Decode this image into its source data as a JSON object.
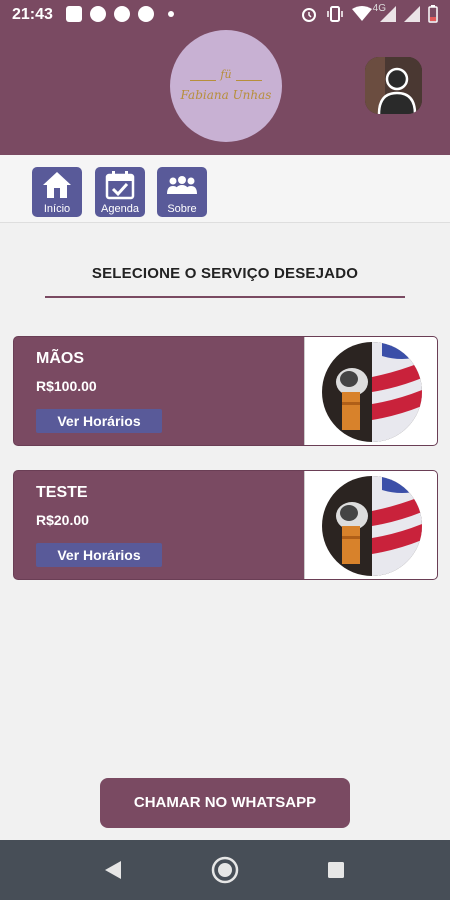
{
  "status_bar": {
    "time": "21:43",
    "network": "4G",
    "icons": [
      "message-icon",
      "facebook-icon",
      "pinterest-icon",
      "pinterest-icon",
      "dot-icon",
      "alarm-icon",
      "vibrate-icon",
      "wifi-icon",
      "signal-icon",
      "battery-icon"
    ]
  },
  "header": {
    "logo_mark": "fü",
    "logo_name": "Fabiana Unhas",
    "profile_icon": "user-icon"
  },
  "nav": {
    "items": [
      {
        "label": "Início",
        "icon": "home-icon"
      },
      {
        "label": "Agenda",
        "icon": "calendar-check-icon"
      },
      {
        "label": "Sobre",
        "icon": "group-icon"
      }
    ]
  },
  "main": {
    "title": "SELECIONE O SERVIÇO DESEJADO",
    "services": [
      {
        "name": "MÃOS",
        "price": "R$100.00",
        "button": "Ver Horários",
        "image": "barber-shaving-brush-image"
      },
      {
        "name": "TESTE",
        "price": "R$20.00",
        "button": "Ver Horários",
        "image": "barber-shaving-brush-image"
      }
    ]
  },
  "whatsapp_button": "CHAMAR NO WHATSAPP",
  "colors": {
    "primary": "#7a4a62",
    "accent": "#595a99",
    "logo_bg": "#c8b1d3",
    "logo_gold": "#b78f3c",
    "system_nav": "#474e57"
  }
}
